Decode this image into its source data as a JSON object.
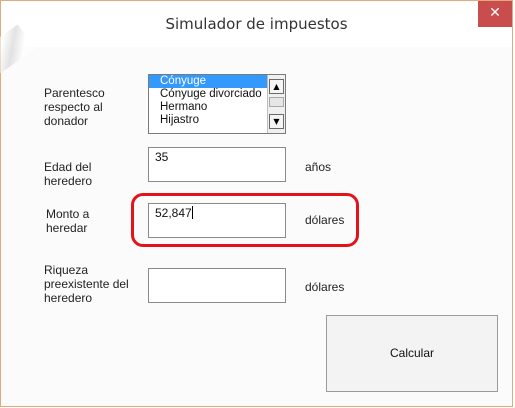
{
  "window": {
    "title": "Simulador de impuestos",
    "close_glyph": "✕"
  },
  "labels": {
    "parentesco": "Parentesco respecto al donador",
    "edad": "Edad del heredero",
    "monto": "Monto a heredar",
    "riqueza": "Riqueza preexistente del heredero"
  },
  "relationship_list": {
    "items": [
      "Cónyuge",
      "Cónyuge divorciado",
      "Hermano",
      "Hijastro"
    ],
    "selected_index": 0
  },
  "fields": {
    "edad_value": "35",
    "monto_value": "52,847",
    "riqueza_value": ""
  },
  "units": {
    "edad": "años",
    "monto": "dólares",
    "riqueza": "dólares"
  },
  "buttons": {
    "calcular": "Calcular"
  },
  "colors": {
    "close_button": "#c94d4d",
    "selection": "#3399ff",
    "highlight": "#e2141a"
  },
  "icons": {
    "close": "close-icon",
    "scroll_up": "arrow-up-icon",
    "scroll_down": "arrow-down-icon"
  }
}
